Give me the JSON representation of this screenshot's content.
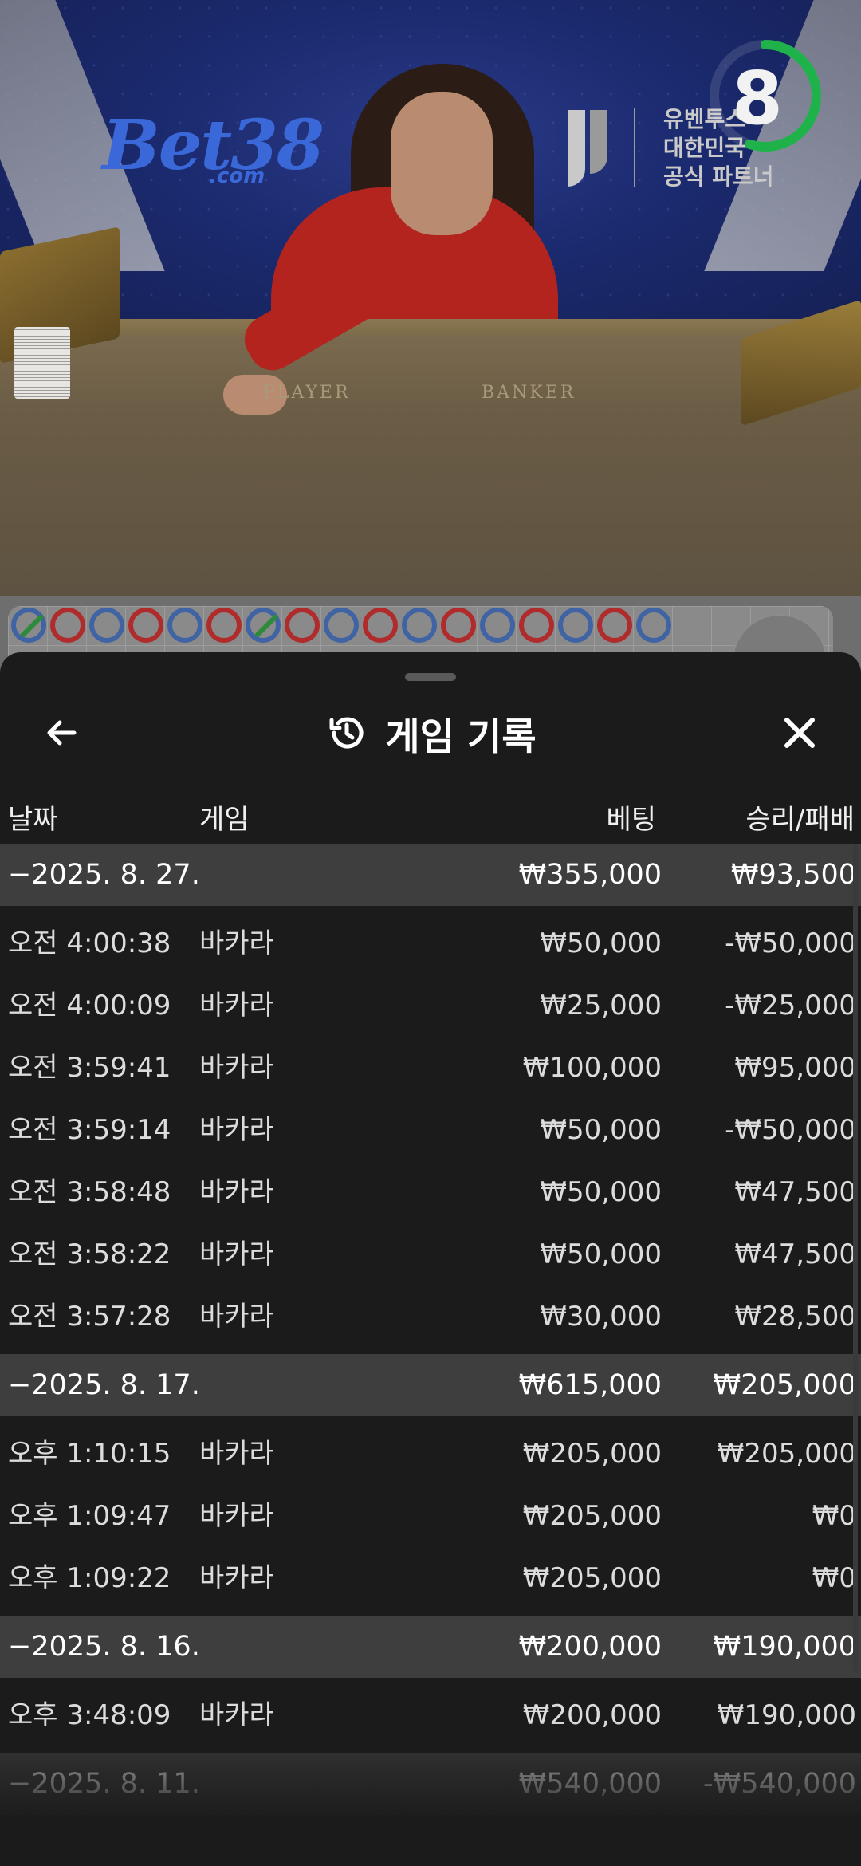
{
  "video": {
    "brand_logo": "Bet38",
    "brand_logo_sub": ".com",
    "partner_lines": [
      "유벤투스",
      "대한민국",
      "공식 파트너"
    ],
    "countdown": "8",
    "countdown_fraction": 0.55,
    "table_labels": [
      "PLAYER",
      "BANKER"
    ]
  },
  "scoreboard": {
    "beads_top": [
      "banker-tie",
      "player",
      "banker",
      "player",
      "banker",
      "player",
      "banker-tie",
      "player",
      "banker",
      "player",
      "banker",
      "player",
      "banker",
      "player",
      "banker",
      "player",
      "banker"
    ]
  },
  "sheet": {
    "title": "게임 기록",
    "title_icon": "history-icon",
    "back_icon": "arrow-left-icon",
    "close_icon": "close-icon",
    "columns": {
      "date": "날짜",
      "game": "게임",
      "bet": "베팅",
      "win_loss": "승리/패배"
    },
    "groups": [
      {
        "date": "−2025. 8. 27.",
        "total_bet": "₩355,000",
        "total_win": "₩93,500",
        "rows": [
          {
            "time": "오전 4:00:38",
            "game": "바카라",
            "bet": "₩50,000",
            "win": "-₩50,000"
          },
          {
            "time": "오전 4:00:09",
            "game": "바카라",
            "bet": "₩25,000",
            "win": "-₩25,000"
          },
          {
            "time": "오전 3:59:41",
            "game": "바카라",
            "bet": "₩100,000",
            "win": "₩95,000"
          },
          {
            "time": "오전 3:59:14",
            "game": "바카라",
            "bet": "₩50,000",
            "win": "-₩50,000"
          },
          {
            "time": "오전 3:58:48",
            "game": "바카라",
            "bet": "₩50,000",
            "win": "₩47,500"
          },
          {
            "time": "오전 3:58:22",
            "game": "바카라",
            "bet": "₩50,000",
            "win": "₩47,500"
          },
          {
            "time": "오전 3:57:28",
            "game": "바카라",
            "bet": "₩30,000",
            "win": "₩28,500"
          }
        ]
      },
      {
        "date": "−2025. 8. 17.",
        "total_bet": "₩615,000",
        "total_win": "₩205,000",
        "rows": [
          {
            "time": "오후 1:10:15",
            "game": "바카라",
            "bet": "₩205,000",
            "win": "₩205,000"
          },
          {
            "time": "오후 1:09:47",
            "game": "바카라",
            "bet": "₩205,000",
            "win": "₩0"
          },
          {
            "time": "오후 1:09:22",
            "game": "바카라",
            "bet": "₩205,000",
            "win": "₩0"
          }
        ]
      },
      {
        "date": "−2025. 8. 16.",
        "total_bet": "₩200,000",
        "total_win": "₩190,000",
        "rows": [
          {
            "time": "오후 3:48:09",
            "game": "바카라",
            "bet": "₩200,000",
            "win": "₩190,000"
          }
        ]
      },
      {
        "date": "−2025. 8. 11.",
        "total_bet": "₩540,000",
        "total_win": "-₩540,000",
        "rows": []
      }
    ]
  }
}
